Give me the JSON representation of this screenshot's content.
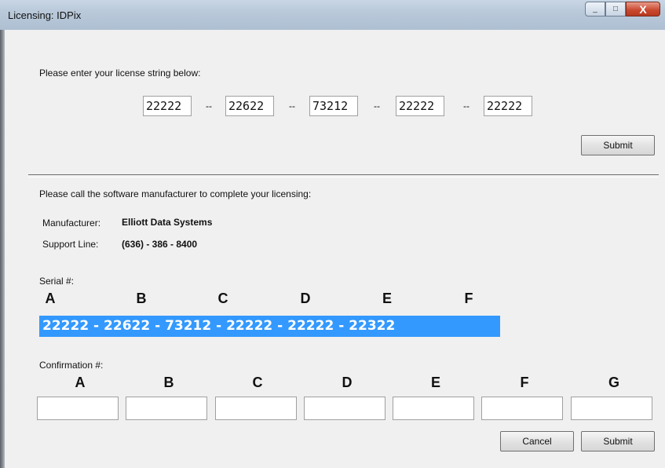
{
  "window": {
    "title": "Licensing: IDPix",
    "minimize_glyph": "_",
    "maximize_glyph": "□",
    "close_glyph": "X"
  },
  "license": {
    "prompt": "Please enter your license string below:",
    "fields": [
      "22222",
      "22622",
      "73212",
      "22222",
      "22222"
    ],
    "separator": "--",
    "submit_label": "Submit"
  },
  "manufacturer_section": {
    "prompt": "Please call the software manufacturer to complete your licensing:",
    "manufacturer_label": "Manufacturer:",
    "manufacturer_value": "Elliott Data Systems",
    "support_label": "Support Line:",
    "support_value": "(636) - 386 - 8400"
  },
  "serial": {
    "label": "Serial #:",
    "letters": [
      "A",
      "B",
      "C",
      "D",
      "E",
      "F"
    ],
    "value": "22222 - 22622 - 73212 - 22222 - 22222 - 22322"
  },
  "confirmation": {
    "label": "Confirmation #:",
    "letters": [
      "A",
      "B",
      "C",
      "D",
      "E",
      "F",
      "G"
    ],
    "values": [
      "",
      "",
      "",
      "",
      "",
      "",
      ""
    ]
  },
  "footer": {
    "cancel_label": "Cancel",
    "submit_label": "Submit"
  }
}
